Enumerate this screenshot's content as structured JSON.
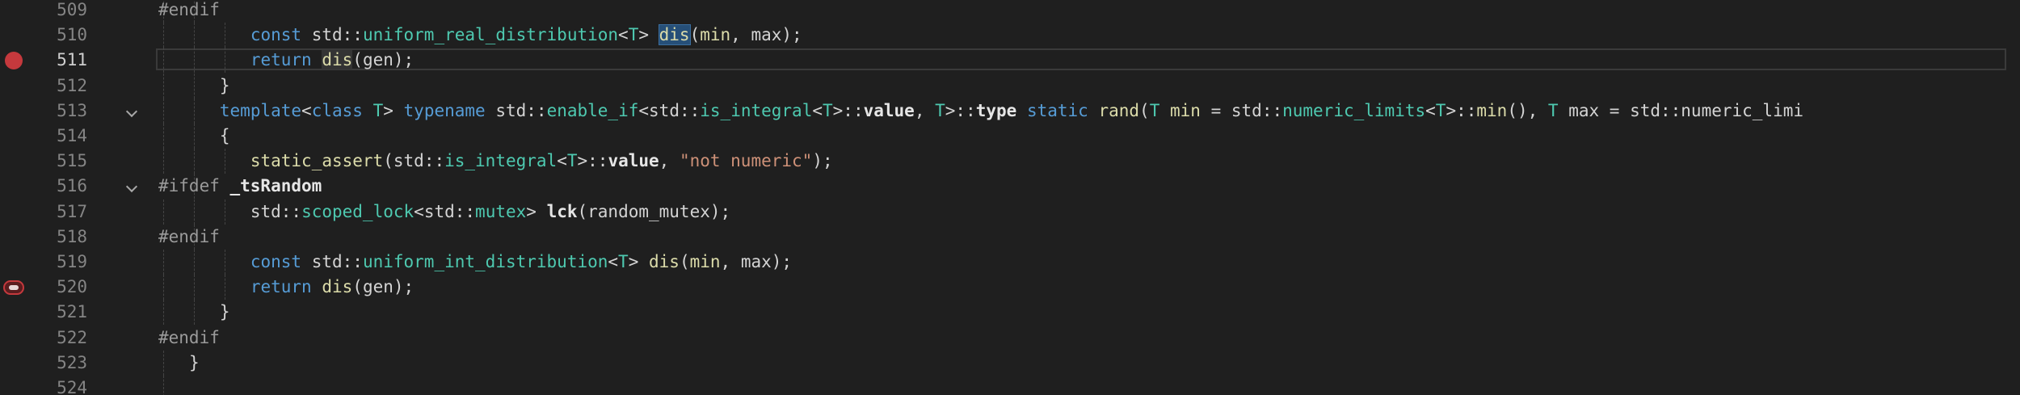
{
  "editor": {
    "lines": [
      {
        "num": "509",
        "text": "#endif"
      },
      {
        "num": "510",
        "text": "const std::uniform_real_distribution<T> dis(min, max);"
      },
      {
        "num": "511",
        "text": "return dis(gen);",
        "breakpoint": "active",
        "current": true
      },
      {
        "num": "512",
        "text": "}"
      },
      {
        "num": "513",
        "text": "template<class T> typename std::enable_if<std::is_integral<T>::value, T>::type static rand(T min = std::numeric_limits<T>::min(), T max = std::numeric_limi",
        "fold": true
      },
      {
        "num": "514",
        "text": "{"
      },
      {
        "num": "515",
        "text": "static_assert(std::is_integral<T>::value, \"not numeric\");"
      },
      {
        "num": "516",
        "text": "#ifdef _tsRandom",
        "fold": true
      },
      {
        "num": "517",
        "text": "std::scoped_lock<std::mutex> lck(random_mutex);"
      },
      {
        "num": "518",
        "text": "#endif"
      },
      {
        "num": "519",
        "text": "const std::uniform_int_distribution<T> dis(min, max);"
      },
      {
        "num": "520",
        "text": "return dis(gen);",
        "breakpoint": "disabled"
      },
      {
        "num": "521",
        "text": "}"
      },
      {
        "num": "522",
        "text": "#endif"
      },
      {
        "num": "523",
        "text": "}"
      },
      {
        "num": "524",
        "text": ""
      }
    ]
  },
  "icons": {
    "breakpoint": "breakpoint-icon",
    "breakpoint_hollow": "breakpoint-disabled-icon",
    "fold": "chevron-down-icon"
  },
  "colors": {
    "background": "#1f1f1f",
    "keyword": "#569cd6",
    "type": "#4ec9b0",
    "function": "#dcdcaa",
    "string": "#ce9178",
    "breakpoint": "#c5393d"
  }
}
